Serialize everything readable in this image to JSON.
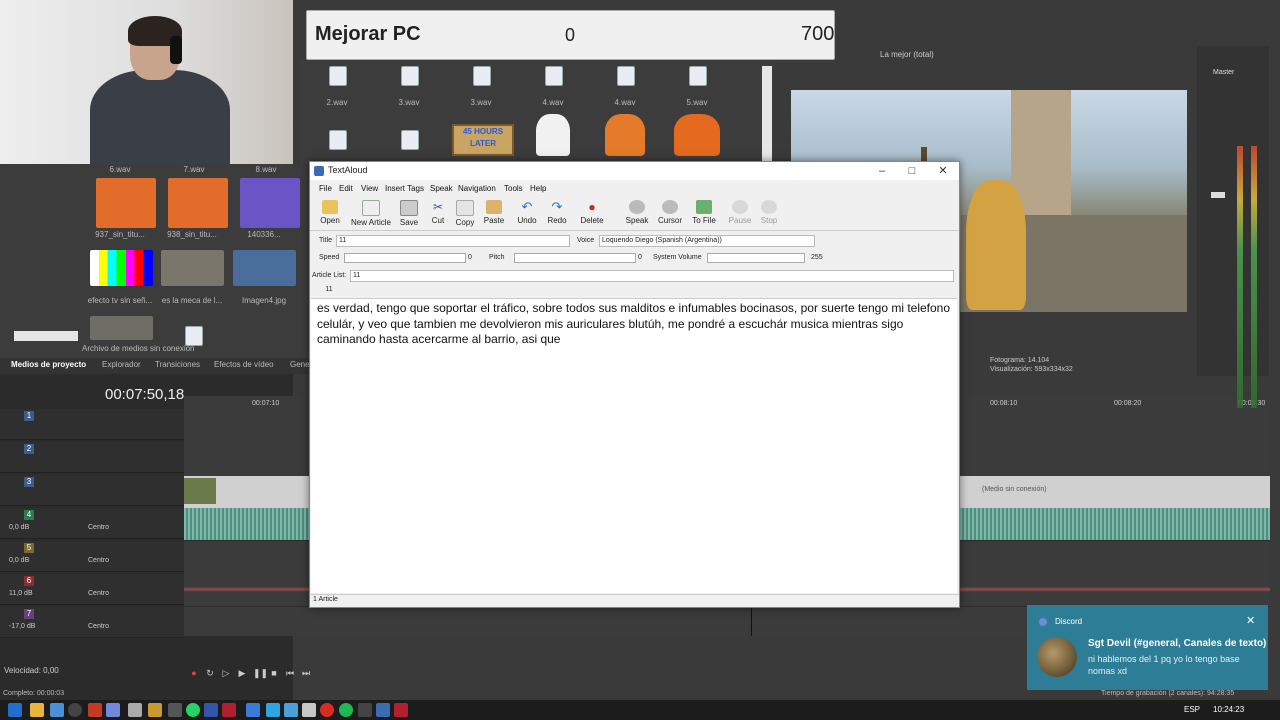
{
  "score": {
    "title": "Mejorar PC",
    "current": "0",
    "goal": "700"
  },
  "project_media": {
    "tabs": [
      "Medios de proyecto",
      "Explorador",
      "Transiciones",
      "Efectos de vídeo",
      "Gene"
    ],
    "thumb_labels": [
      "937_sin_titu...",
      "938_sin_titu...",
      "140336...",
      "efecto tv sin señ...",
      "es la meca de l...",
      "Imagen4.jpg",
      "Archivo de medios sin conexión"
    ],
    "top_labels": [
      "6.wav",
      "7.wav",
      "8.wav"
    ],
    "wav_labels_row1": [
      "2.wav",
      "3.wav",
      "3.wav",
      "4.wav",
      "4.wav",
      "5.wav"
    ],
    "hours_later": "45 HOURS LATER"
  },
  "timeline": {
    "timecode": "00:07:50,18",
    "ruler": [
      "00:07:10",
      "00:08:10",
      "00:08:20",
      "00:08:30"
    ],
    "offline_label": "(Medio sin conexión)",
    "tracks": [
      {
        "num": "1",
        "db": "",
        "pan": ""
      },
      {
        "num": "2",
        "db": "",
        "pan": ""
      },
      {
        "num": "3",
        "db": "",
        "pan": ""
      },
      {
        "num": "4",
        "db": "0,0 dB",
        "pan": "Centro"
      },
      {
        "num": "5",
        "db": "0,0 dB",
        "pan": "Centro"
      },
      {
        "num": "6",
        "db": "11,0 dB",
        "pan": "Centro"
      },
      {
        "num": "7",
        "db": "-17,0 dB",
        "pan": "Centro"
      }
    ],
    "velocity": "Velocidad: 0,00",
    "complete": "Completo: 00:00:03",
    "record_time": "Tiempo de grabación (2 canales): 94:28:35"
  },
  "preview": {
    "quality": "La mejor (total)",
    "master_label": "Master",
    "frame": "Fotograma:  14.104",
    "display": "Visualización:  593x334x32"
  },
  "textaloud": {
    "title": "TextAloud",
    "menu": [
      "File",
      "Edit",
      "View",
      "Insert Tags",
      "Speak",
      "Navigation",
      "Tools",
      "Help"
    ],
    "toolbar": [
      {
        "label": "Open",
        "icon": "folder-icon",
        "disabled": false
      },
      {
        "label": "New Article",
        "icon": "new-article-icon",
        "disabled": false
      },
      {
        "label": "Save",
        "icon": "save-icon",
        "disabled": false
      },
      {
        "label": "Cut",
        "icon": "cut-icon",
        "disabled": false
      },
      {
        "label": "Copy",
        "icon": "copy-icon",
        "disabled": false
      },
      {
        "label": "Paste",
        "icon": "paste-icon",
        "disabled": false
      },
      {
        "label": "Undo",
        "icon": "undo-icon",
        "disabled": false
      },
      {
        "label": "Redo",
        "icon": "redo-icon",
        "disabled": false
      },
      {
        "label": "Delete",
        "icon": "delete-icon",
        "disabled": false
      },
      {
        "label": "Speak",
        "icon": "speak-icon",
        "disabled": false
      },
      {
        "label": "Cursor",
        "icon": "cursor-icon",
        "disabled": false
      },
      {
        "label": "To File",
        "icon": "to-file-icon",
        "disabled": false
      },
      {
        "label": "Pause",
        "icon": "pause-icon",
        "disabled": true
      },
      {
        "label": "Stop",
        "icon": "stop-icon",
        "disabled": true
      }
    ],
    "title_label": "Title",
    "title_value": "11",
    "voice_label": "Voice",
    "voice_value": "Loquendo Diego (Spanish (Argentina))",
    "speed_label": "Speed",
    "speed_value": "0",
    "pitch_label": "Pitch",
    "pitch_value": "0",
    "system_volume_label": "System Volume",
    "system_volume_value": "255",
    "article_list_label": "Article List:",
    "article_list_value": "11",
    "doc_tab": "11",
    "body": "es verdad, tengo que soportar el tráfico, sobre todos sus malditos e infumables bocinasos, por suerte tengo mi telefono celulár, y veo que tambien me devolvieron mis auriculares blutúh, me pondré a escuchár musica mientras sigo caminando hasta acercarme al barrio, asi que",
    "status": "1 Article"
  },
  "discord": {
    "app": "Discord",
    "title": "Sgt Devil (#general, Canales de texto)",
    "message": "ni hablemos del 1 pq yo lo tengo base nomas xd"
  },
  "taskbar": {
    "lang": "ESP",
    "time": "10:24:23"
  },
  "colors": {
    "discord_toast": "#2d7d96",
    "vegas_bg": "#3a3a3a",
    "taskbar": "#1c1c1c"
  }
}
